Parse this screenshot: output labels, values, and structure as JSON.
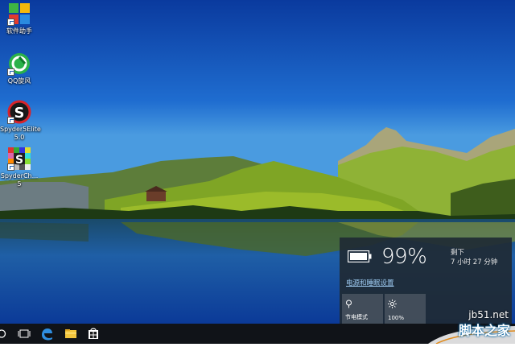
{
  "desktop": {
    "icons": [
      {
        "label": "软件助手",
        "icon": "software-assistant-icon"
      },
      {
        "label": "QQ旋风",
        "icon": "qq-whirlwind-icon"
      },
      {
        "label": "Spyder5Elite 5.0",
        "icon": "spyder-elite-icon"
      },
      {
        "label": "SpyderCh... 5",
        "icon": "spyder-checkr-icon"
      }
    ]
  },
  "taskbar": {
    "buttons": [
      "cortana-circle-icon",
      "task-view-icon",
      "edge-icon",
      "file-explorer-icon",
      "store-icon"
    ]
  },
  "battery": {
    "percent": "99%",
    "remaining_label": "剩下",
    "remaining_time": "7 小时 27 分钟",
    "power_settings_link": "电源和睡眠设置",
    "tiles": [
      {
        "label": "节电模式",
        "icon": "battery-saver-icon"
      },
      {
        "label": "100%",
        "icon": "brightness-icon"
      }
    ]
  },
  "watermark": {
    "site": "jb51.net",
    "name": "脚本之家"
  },
  "colors": {
    "sky_top": "#0a3fa8",
    "accent_link": "#9ecbf2",
    "flyout_bg": "#1f2a34"
  }
}
